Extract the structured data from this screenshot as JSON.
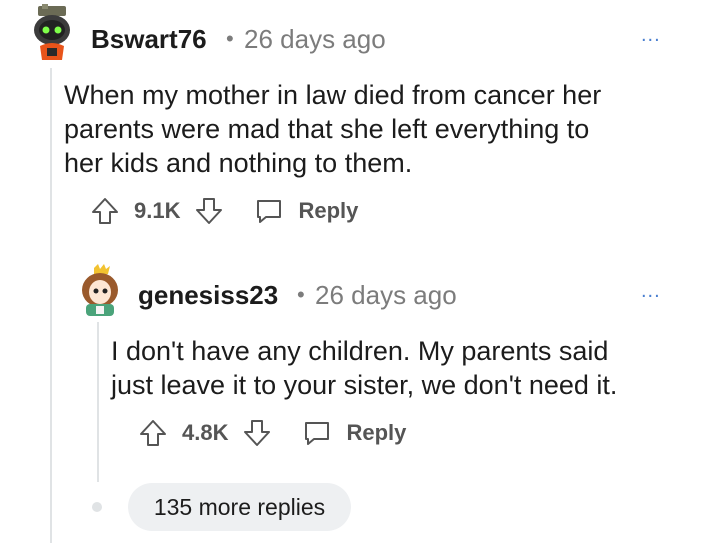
{
  "comment": {
    "username": "Bswart76",
    "separator": "•",
    "time": "26 days ago",
    "more": "...",
    "body": "When my mother in law died from cancer her parents were mad that she left everything to her kids and nothing to them.",
    "upvotes": "9.1K",
    "reply_label": "Reply"
  },
  "reply": {
    "username": "genesiss23",
    "separator": "•",
    "time": "26 days ago",
    "more": "...",
    "body": "I don't have any children. My parents said just leave it to your sister, we don't need it.",
    "upvotes": "4.8K",
    "reply_label": "Reply"
  },
  "more_replies": "135 more replies",
  "colors": {
    "text": "#1c1c1c",
    "muted": "#7c7c7c",
    "accent": "#4a7fd0",
    "thread_line": "#e0e3e5"
  },
  "icons": [
    "robot-avatar-icon",
    "girl-avatar-icon",
    "upvote-arrow-icon",
    "downvote-arrow-icon",
    "reply-bubble-icon",
    "more-dots-icon"
  ]
}
